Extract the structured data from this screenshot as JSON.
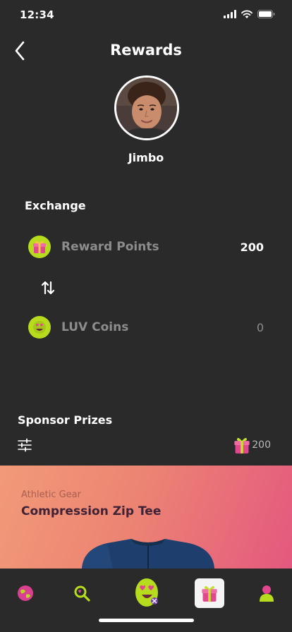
{
  "status_bar": {
    "time": "12:34"
  },
  "header": {
    "title": "Rewards"
  },
  "profile": {
    "name": "Jimbo"
  },
  "exchange": {
    "title": "Exchange",
    "reward_points": {
      "label": "Reward Points",
      "value": "200"
    },
    "luv_coins": {
      "label": "LUV Coins",
      "value": "0"
    }
  },
  "sponsor": {
    "title": "Sponsor Prizes",
    "points_summary": "200",
    "prize": {
      "category": "Athletic Gear",
      "name": "Compression Zip Tee"
    }
  },
  "icons": {
    "back": "chevron-left-icon",
    "swap": "swap-arrows-icon",
    "filter": "sliders-icon",
    "gift": "gift-icon",
    "coin": "luv-coin-icon"
  },
  "tabs": [
    "globe",
    "search-heart",
    "luv-mascot",
    "rewards",
    "profile"
  ],
  "colors": {
    "background": "#2a2a2a",
    "accent_green": "#b7dc1d",
    "gift_pink": "#e0478f",
    "card_start": "#f29a78",
    "card_end": "#e4587f"
  }
}
